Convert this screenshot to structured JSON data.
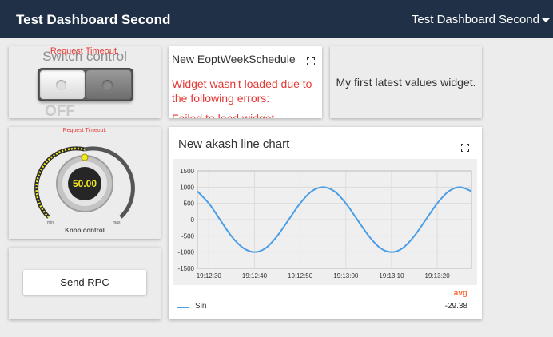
{
  "header": {
    "title": "Test Dashboard Second",
    "dashboard_selector": "Test Dashboard Second"
  },
  "switch_widget": {
    "error": "Request Timeout.",
    "title": "Switch control",
    "state": "OFF"
  },
  "schedule_widget": {
    "title": "New EoptWeekSchedule",
    "error_line1": "Widget wasn't loaded due to the following errors:",
    "error_line2": "Failed to load widget"
  },
  "latest_values_widget": {
    "text": "My first latest values widget."
  },
  "knob_widget": {
    "error": "Request Timeout.",
    "value": "50.00",
    "label": "Knob control",
    "min_label": "min",
    "max_label": "max",
    "level_fraction": 0.5
  },
  "rpc_widget": {
    "button_label": "Send RPC"
  },
  "chart_widget": {
    "title": "New akash line chart",
    "avg_label": "avg",
    "legend": [
      {
        "name": "Sin",
        "avg": "-29.38",
        "color": "#4b9ee6"
      }
    ]
  },
  "chart_data": {
    "type": "line",
    "x_ticks": [
      "19:12:30",
      "19:12:40",
      "19:12:50",
      "19:13:00",
      "19:13:10",
      "19:13:20"
    ],
    "ylim": [
      -1500,
      1500
    ],
    "y_ticks": [
      1500,
      1000,
      500,
      0,
      -500,
      -1000,
      -1500
    ],
    "grid": true,
    "series": [
      {
        "name": "Sin",
        "color": "#4b9ee6",
        "x_seconds_from_1912_30": [
          -2.5,
          0,
          2.5,
          5,
          7.5,
          10,
          12.5,
          15,
          17.5,
          20,
          22.5,
          25,
          27.5,
          30,
          32.5,
          35,
          37.5,
          40,
          42.5,
          45,
          47.5,
          50,
          52.5,
          55,
          57.5
        ],
        "values": [
          870,
          500,
          -10,
          -520,
          -870,
          -1000,
          -870,
          -500,
          0,
          500,
          870,
          1000,
          870,
          500,
          0,
          -500,
          -870,
          -1000,
          -870,
          -500,
          0,
          500,
          870,
          1000,
          870
        ]
      }
    ]
  }
}
